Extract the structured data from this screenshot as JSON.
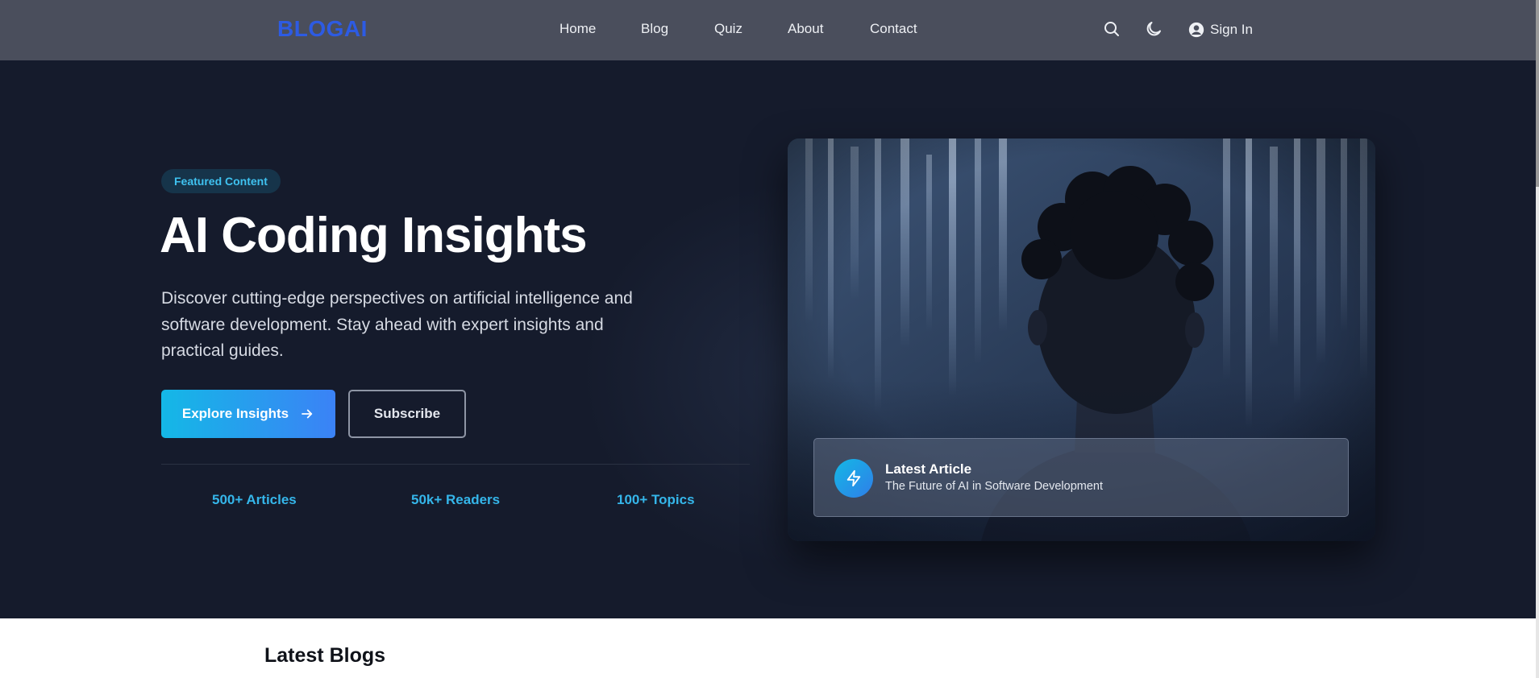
{
  "nav": {
    "logo": "BLOGAI",
    "links": [
      "Home",
      "Blog",
      "Quiz",
      "About",
      "Contact"
    ],
    "icons": [
      "search-icon",
      "moon-icon",
      "user-circle-icon"
    ],
    "sign_in": "Sign In"
  },
  "hero": {
    "badge": "Featured Content",
    "title": "AI Coding Insights",
    "description": "Discover cutting-edge perspectives on artificial intelligence and software development. Stay ahead with expert insights and practical guides.",
    "primary_button": "Explore Insights",
    "primary_button_icon": "arrow-right-icon",
    "secondary_button": "Subscribe",
    "stats": [
      "500+ Articles",
      "50k+ Readers",
      "100+ Topics"
    ]
  },
  "featured_card": {
    "icon": "lightning-icon",
    "label": "Latest Article",
    "title": "The Future of AI in Software Development"
  },
  "latest_section": {
    "title": "Latest Blogs"
  },
  "colors": {
    "navbar": "#4a4e5c",
    "hero_bg": "#151b2c",
    "logo": "#2d5be3",
    "accent": "#35b6ea",
    "button_gradient_start": "#14b8e6",
    "button_gradient_end": "#3b82f6"
  }
}
